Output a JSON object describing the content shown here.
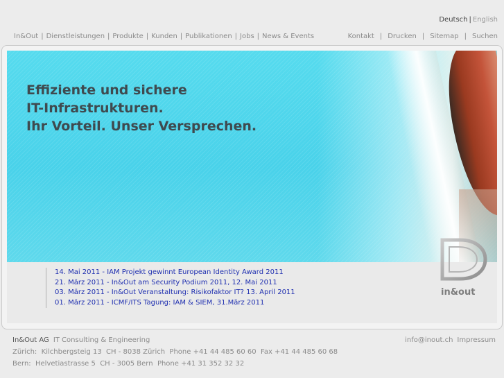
{
  "language": {
    "active": "Deutsch",
    "separator": "|",
    "other": "English"
  },
  "main_nav": {
    "items": [
      "In&Out",
      "Dienstleistungen",
      "Produkte",
      "Kunden",
      "Publikationen",
      "Jobs",
      "News & Events"
    ],
    "separator": "|"
  },
  "util_nav": {
    "items": [
      "Kontakt",
      "Drucken",
      "Sitemap",
      "Suchen"
    ],
    "separator": "|"
  },
  "hero": {
    "headline": [
      "Effiziente und sichere",
      "IT-Infrastrukturen.",
      "Ihr Vorteil. Unser Versprechen."
    ]
  },
  "news": [
    "14. Mai 2011 - IAM Projekt gewinnt European Identity Award 2011",
    "21. März 2011 - In&Out am Security Podium 2011, 12. Mai 2011",
    "03. März 2011 - In&Out Veranstaltung: Risikofaktor IT? 13. April 2011",
    "01. März 2011 - ICMF/ITS Tagung: IAM & SIEM, 31.März 2011"
  ],
  "logo": {
    "text": "in&out"
  },
  "footer": {
    "company": "In&Out AG",
    "tagline": "IT Consulting & Engineering",
    "zurich": "Zürich:  Kilchbergsteig 13  CH - 8038 Zürich  Phone +41 44 485 60 60  Fax +41 44 485 60 68",
    "bern": "Bern:  Helvetiastrasse 5  CH - 3005 Bern  Phone +41 31 352 32 32",
    "email": "info@inout.ch",
    "impressum": "Impressum"
  },
  "colors": {
    "background": "#ececec",
    "hero_cyan": "#4fd6ec",
    "headline": "#3f4a4f",
    "news_link": "#1f2fb0",
    "nav_text": "#8a8a8a"
  }
}
